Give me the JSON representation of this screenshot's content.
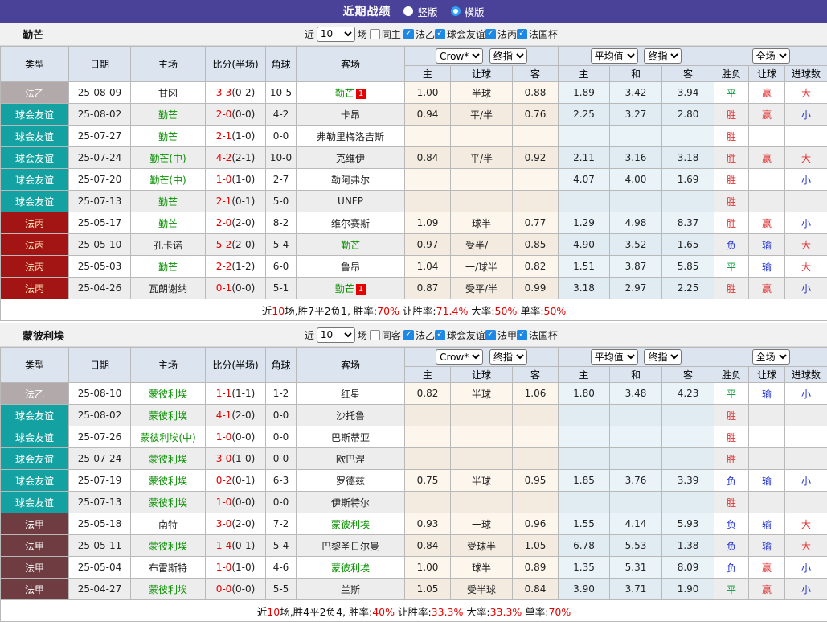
{
  "header": {
    "title": "近期战绩",
    "vertical_label": "竖版",
    "horizontal_label": "横版",
    "selected_layout": "横版"
  },
  "colors": {
    "topbar_purple": "#4a4199",
    "badge_ligue2": "#b2aaaa",
    "badge_friendly_teal": "#14a1a1",
    "badge_ligue3_red": "#a31414",
    "badge_ligue1_maroon": "#6e3c41",
    "score_red": "#e60000",
    "team_green": "#089000",
    "win_red": "#e03333",
    "lose_blue": "#2233cc",
    "draw_green": "#009933",
    "checkbox_blue": "#1e88e5",
    "header_cell_bg": "#dce4ef"
  },
  "table": {
    "static_headers": [
      "类型",
      "日期",
      "主场",
      "比分(半场)",
      "角球",
      "客场"
    ],
    "sub_headers": [
      "主",
      "让球",
      "客",
      "主",
      "和",
      "客",
      "胜负",
      "让球",
      "进球数"
    ],
    "dropdowns": {
      "odds_source": "Crow*",
      "odds_time": "终指",
      "avg_source": "平均值",
      "avg_time": "终指",
      "scope": "全场"
    }
  },
  "sections": [
    {
      "team": "勤芒",
      "filter": {
        "near_label": "近",
        "count": "10",
        "games_label": "场",
        "same_label": "同主",
        "same_checked": false,
        "leagues": [
          {
            "label": "法乙",
            "checked": true
          },
          {
            "label": "球会友谊",
            "checked": true
          },
          {
            "label": "法丙",
            "checked": true
          },
          {
            "label": "法国杯",
            "checked": true
          }
        ]
      },
      "rows": [
        {
          "league": "法乙",
          "lg": "l2",
          "date": "25-08-09",
          "home": "甘冈",
          "hG": false,
          "hB": "",
          "ft": "3-3",
          "ht": "(0-2)",
          "corner": "10-5",
          "away": "勤芒",
          "aG": true,
          "aB": "1",
          "odds": [
            "1.00",
            "半球",
            "0.88"
          ],
          "avg": [
            "1.89",
            "3.42",
            "3.94"
          ],
          "res": [
            [
              "平",
              "g"
            ],
            [
              "赢",
              "r"
            ],
            [
              "大",
              "r"
            ]
          ]
        },
        {
          "league": "球会友谊",
          "lg": "fr",
          "date": "25-08-02",
          "home": "勤芒",
          "hG": true,
          "hB": "",
          "ft": "2-0",
          "ht": "(0-0)",
          "corner": "4-2",
          "away": "卡昂",
          "aG": false,
          "aB": "",
          "odds": [
            "0.94",
            "平/半",
            "0.76"
          ],
          "avg": [
            "2.25",
            "3.27",
            "2.80"
          ],
          "res": [
            [
              "胜",
              "r"
            ],
            [
              "赢",
              "r"
            ],
            [
              "小",
              "b"
            ]
          ]
        },
        {
          "league": "球会友谊",
          "lg": "fr",
          "date": "25-07-27",
          "home": "勤芒",
          "hG": true,
          "hB": "",
          "ft": "2-1",
          "ht": "(1-0)",
          "corner": "0-0",
          "away": "弗勒里梅洛吉斯",
          "aG": false,
          "aB": "",
          "odds": [
            "",
            "",
            ""
          ],
          "avg": [
            "",
            "",
            ""
          ],
          "res": [
            [
              "胜",
              "r"
            ],
            [
              "",
              ""
            ],
            [
              "",
              ""
            ]
          ]
        },
        {
          "league": "球会友谊",
          "lg": "fr",
          "date": "25-07-24",
          "home": "勤芒(中)",
          "hG": true,
          "hB": "",
          "ft": "4-2",
          "ht": "(2-1)",
          "corner": "10-0",
          "away": "克维伊",
          "aG": false,
          "aB": "",
          "odds": [
            "0.84",
            "平/半",
            "0.92"
          ],
          "avg": [
            "2.11",
            "3.16",
            "3.18"
          ],
          "res": [
            [
              "胜",
              "r"
            ],
            [
              "赢",
              "r"
            ],
            [
              "大",
              "r"
            ]
          ]
        },
        {
          "league": "球会友谊",
          "lg": "fr",
          "date": "25-07-20",
          "home": "勤芒(中)",
          "hG": true,
          "hB": "",
          "ft": "1-0",
          "ht": "(1-0)",
          "corner": "2-7",
          "away": "勒阿弗尔",
          "aG": false,
          "aB": "",
          "odds": [
            "",
            "",
            ""
          ],
          "avg": [
            "4.07",
            "4.00",
            "1.69"
          ],
          "res": [
            [
              "胜",
              "r"
            ],
            [
              "",
              ""
            ],
            [
              "小",
              "b"
            ]
          ]
        },
        {
          "league": "球会友谊",
          "lg": "fr",
          "date": "25-07-13",
          "home": "勤芒",
          "hG": true,
          "hB": "",
          "ft": "2-1",
          "ht": "(0-1)",
          "corner": "5-0",
          "away": "UNFP",
          "aG": false,
          "aB": "",
          "odds": [
            "",
            "",
            ""
          ],
          "avg": [
            "",
            "",
            ""
          ],
          "res": [
            [
              "胜",
              "r"
            ],
            [
              "",
              ""
            ],
            [
              "",
              ""
            ]
          ]
        },
        {
          "league": "法丙",
          "lg": "l3",
          "date": "25-05-17",
          "home": "勤芒",
          "hG": true,
          "hB": "",
          "ft": "2-0",
          "ht": "(2-0)",
          "corner": "8-2",
          "away": "维尔赛斯",
          "aG": false,
          "aB": "",
          "odds": [
            "1.09",
            "球半",
            "0.77"
          ],
          "avg": [
            "1.29",
            "4.98",
            "8.37"
          ],
          "res": [
            [
              "胜",
              "r"
            ],
            [
              "赢",
              "r"
            ],
            [
              "小",
              "b"
            ]
          ]
        },
        {
          "league": "法丙",
          "lg": "l3",
          "date": "25-05-10",
          "home": "孔卡诺",
          "hG": false,
          "hB": "",
          "ft": "5-2",
          "ht": "(2-0)",
          "corner": "5-4",
          "away": "勤芒",
          "aG": true,
          "aB": "",
          "odds": [
            "0.97",
            "受半/一",
            "0.85"
          ],
          "avg": [
            "4.90",
            "3.52",
            "1.65"
          ],
          "res": [
            [
              "负",
              "b"
            ],
            [
              "输",
              "b"
            ],
            [
              "大",
              "r"
            ]
          ]
        },
        {
          "league": "法丙",
          "lg": "l3",
          "date": "25-05-03",
          "home": "勤芒",
          "hG": true,
          "hB": "",
          "ft": "2-2",
          "ht": "(1-2)",
          "corner": "6-0",
          "away": "鲁昂",
          "aG": false,
          "aB": "",
          "odds": [
            "1.04",
            "一/球半",
            "0.82"
          ],
          "avg": [
            "1.51",
            "3.87",
            "5.85"
          ],
          "res": [
            [
              "平",
              "g"
            ],
            [
              "输",
              "b"
            ],
            [
              "大",
              "r"
            ]
          ]
        },
        {
          "league": "法丙",
          "lg": "l3",
          "date": "25-04-26",
          "home": "瓦朗谢纳",
          "hG": false,
          "hB": "",
          "ft": "0-1",
          "ht": "(0-0)",
          "corner": "5-1",
          "away": "勤芒",
          "aG": true,
          "aB": "1",
          "odds": [
            "0.87",
            "受平/半",
            "0.99"
          ],
          "avg": [
            "3.18",
            "2.97",
            "2.25"
          ],
          "res": [
            [
              "胜",
              "r"
            ],
            [
              "赢",
              "r"
            ],
            [
              "小",
              "b"
            ]
          ]
        }
      ],
      "summary_parts": [
        [
          "近",
          "k"
        ],
        [
          "10",
          "r"
        ],
        [
          "场,胜7平2负1, 胜率:",
          "k"
        ],
        [
          "70%",
          "r"
        ],
        [
          " 让胜率:",
          "k"
        ],
        [
          "71.4%",
          "r"
        ],
        [
          " 大率:",
          "k"
        ],
        [
          "50%",
          "r"
        ],
        [
          " 单率:",
          "k"
        ],
        [
          "50%",
          "r"
        ]
      ]
    },
    {
      "team": "蒙彼利埃",
      "filter": {
        "near_label": "近",
        "count": "10",
        "games_label": "场",
        "same_label": "同客",
        "same_checked": false,
        "leagues": [
          {
            "label": "法乙",
            "checked": true
          },
          {
            "label": "球会友谊",
            "checked": true
          },
          {
            "label": "法甲",
            "checked": true
          },
          {
            "label": "法国杯",
            "checked": true
          }
        ]
      },
      "rows": [
        {
          "league": "法乙",
          "lg": "l2",
          "date": "25-08-10",
          "home": "蒙彼利埃",
          "hG": true,
          "hB": "",
          "ft": "1-1",
          "ht": "(1-1)",
          "corner": "1-2",
          "away": "红星",
          "aG": false,
          "aB": "",
          "odds": [
            "0.82",
            "半球",
            "1.06"
          ],
          "avg": [
            "1.80",
            "3.48",
            "4.23"
          ],
          "res": [
            [
              "平",
              "g"
            ],
            [
              "输",
              "b"
            ],
            [
              "小",
              "b"
            ]
          ]
        },
        {
          "league": "球会友谊",
          "lg": "fr",
          "date": "25-08-02",
          "home": "蒙彼利埃",
          "hG": true,
          "hB": "",
          "ft": "4-1",
          "ht": "(2-0)",
          "corner": "0-0",
          "away": "沙托鲁",
          "aG": false,
          "aB": "",
          "odds": [
            "",
            "",
            ""
          ],
          "avg": [
            "",
            "",
            ""
          ],
          "res": [
            [
              "胜",
              "r"
            ],
            [
              "",
              ""
            ],
            [
              "",
              ""
            ]
          ]
        },
        {
          "league": "球会友谊",
          "lg": "fr",
          "date": "25-07-26",
          "home": "蒙彼利埃(中)",
          "hG": true,
          "hB": "",
          "ft": "1-0",
          "ht": "(0-0)",
          "corner": "0-0",
          "away": "巴斯蒂亚",
          "aG": false,
          "aB": "",
          "odds": [
            "",
            "",
            ""
          ],
          "avg": [
            "",
            "",
            ""
          ],
          "res": [
            [
              "胜",
              "r"
            ],
            [
              "",
              ""
            ],
            [
              "",
              ""
            ]
          ]
        },
        {
          "league": "球会友谊",
          "lg": "fr",
          "date": "25-07-24",
          "home": "蒙彼利埃",
          "hG": true,
          "hB": "",
          "ft": "3-0",
          "ht": "(1-0)",
          "corner": "0-0",
          "away": "欧巴涅",
          "aG": false,
          "aB": "",
          "odds": [
            "",
            "",
            ""
          ],
          "avg": [
            "",
            "",
            ""
          ],
          "res": [
            [
              "胜",
              "r"
            ],
            [
              "",
              ""
            ],
            [
              "",
              ""
            ]
          ]
        },
        {
          "league": "球会友谊",
          "lg": "fr",
          "date": "25-07-19",
          "home": "蒙彼利埃",
          "hG": true,
          "hB": "",
          "ft": "0-2",
          "ht": "(0-1)",
          "corner": "6-3",
          "away": "罗德兹",
          "aG": false,
          "aB": "",
          "odds": [
            "0.75",
            "半球",
            "0.95"
          ],
          "avg": [
            "1.85",
            "3.76",
            "3.39"
          ],
          "res": [
            [
              "负",
              "b"
            ],
            [
              "输",
              "b"
            ],
            [
              "小",
              "b"
            ]
          ]
        },
        {
          "league": "球会友谊",
          "lg": "fr",
          "date": "25-07-13",
          "home": "蒙彼利埃",
          "hG": true,
          "hB": "",
          "ft": "1-0",
          "ht": "(0-0)",
          "corner": "0-0",
          "away": "伊斯特尔",
          "aG": false,
          "aB": "",
          "odds": [
            "",
            "",
            ""
          ],
          "avg": [
            "",
            "",
            ""
          ],
          "res": [
            [
              "胜",
              "r"
            ],
            [
              "",
              ""
            ],
            [
              "",
              ""
            ]
          ]
        },
        {
          "league": "法甲",
          "lg": "l1",
          "date": "25-05-18",
          "home": "南特",
          "hG": false,
          "hB": "",
          "ft": "3-0",
          "ht": "(2-0)",
          "corner": "7-2",
          "away": "蒙彼利埃",
          "aG": true,
          "aB": "",
          "odds": [
            "0.93",
            "一球",
            "0.96"
          ],
          "avg": [
            "1.55",
            "4.14",
            "5.93"
          ],
          "res": [
            [
              "负",
              "b"
            ],
            [
              "输",
              "b"
            ],
            [
              "大",
              "r"
            ]
          ]
        },
        {
          "league": "法甲",
          "lg": "l1",
          "date": "25-05-11",
          "home": "蒙彼利埃",
          "hG": true,
          "hB": "",
          "ft": "1-4",
          "ht": "(0-1)",
          "corner": "5-4",
          "away": "巴黎圣日尔曼",
          "aG": false,
          "aB": "",
          "odds": [
            "0.84",
            "受球半",
            "1.05"
          ],
          "avg": [
            "6.78",
            "5.53",
            "1.38"
          ],
          "res": [
            [
              "负",
              "b"
            ],
            [
              "输",
              "b"
            ],
            [
              "大",
              "r"
            ]
          ]
        },
        {
          "league": "法甲",
          "lg": "l1",
          "date": "25-05-04",
          "home": "布雷斯特",
          "hG": false,
          "hB": "",
          "ft": "1-0",
          "ht": "(1-0)",
          "corner": "4-6",
          "away": "蒙彼利埃",
          "aG": true,
          "aB": "",
          "odds": [
            "1.00",
            "球半",
            "0.89"
          ],
          "avg": [
            "1.35",
            "5.31",
            "8.09"
          ],
          "res": [
            [
              "负",
              "b"
            ],
            [
              "赢",
              "r"
            ],
            [
              "小",
              "b"
            ]
          ]
        },
        {
          "league": "法甲",
          "lg": "l1",
          "date": "25-04-27",
          "home": "蒙彼利埃",
          "hG": true,
          "hB": "",
          "ft": "0-0",
          "ht": "(0-0)",
          "corner": "5-5",
          "away": "兰斯",
          "aG": false,
          "aB": "",
          "odds": [
            "1.05",
            "受半球",
            "0.84"
          ],
          "avg": [
            "3.90",
            "3.71",
            "1.90"
          ],
          "res": [
            [
              "平",
              "g"
            ],
            [
              "赢",
              "r"
            ],
            [
              "小",
              "b"
            ]
          ]
        }
      ],
      "summary_parts": [
        [
          "近",
          "k"
        ],
        [
          "10",
          "r"
        ],
        [
          "场,胜4平2负4, 胜率:",
          "k"
        ],
        [
          "40%",
          "r"
        ],
        [
          " 让胜率:",
          "k"
        ],
        [
          "33.3%",
          "r"
        ],
        [
          " 大率:",
          "k"
        ],
        [
          "33.3%",
          "r"
        ],
        [
          " 单率:",
          "k"
        ],
        [
          "70%",
          "r"
        ]
      ]
    }
  ]
}
